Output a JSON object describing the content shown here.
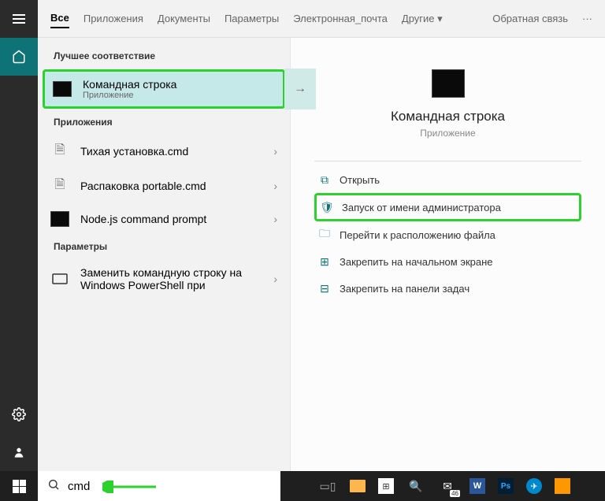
{
  "tabs": {
    "all": "Все",
    "apps": "Приложения",
    "docs": "Документы",
    "params": "Параметры",
    "email": "Электронная_почта",
    "others": "Другие",
    "feedback": "Обратная связь"
  },
  "sections": {
    "best": "Лучшее соответствие",
    "apps": "Приложения",
    "params": "Параметры"
  },
  "results": {
    "cmd": {
      "title": "Командная строка",
      "sub": "Приложение"
    },
    "silent": "Тихая установка.cmd",
    "unpack": "Распаковка portable.cmd",
    "node": "Node.js command prompt",
    "replace": "Заменить командную строку на Windows PowerShell при"
  },
  "preview": {
    "title": "Командная строка",
    "sub": "Приложение"
  },
  "actions": {
    "open": "Открыть",
    "admin": "Запуск от имени администратора",
    "location": "Перейти к расположению файла",
    "pin_start": "Закрепить на начальном экране",
    "pin_task": "Закрепить на панели задач"
  },
  "search": {
    "value": "cmd"
  },
  "mail_badge": "46"
}
